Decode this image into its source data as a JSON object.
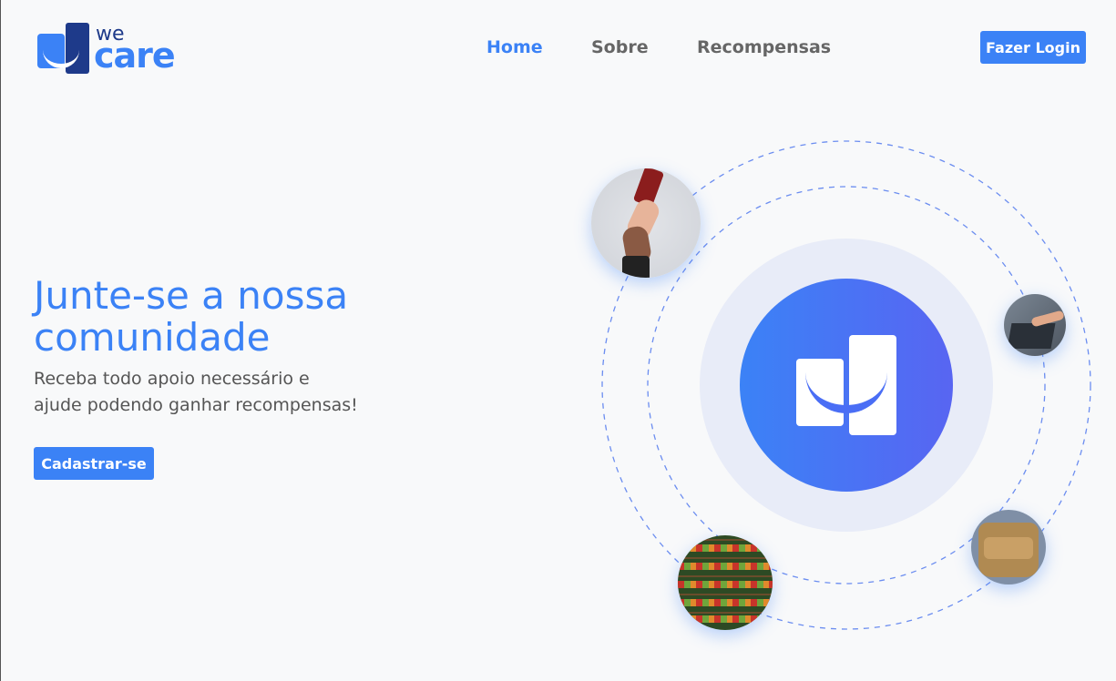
{
  "brand": {
    "line1": "we",
    "line2": "care"
  },
  "nav": {
    "home": "Home",
    "about": "Sobre",
    "rewards": "Recompensas"
  },
  "header": {
    "login_label": "Fazer Login"
  },
  "hero": {
    "title_line1": "Junte-se a nossa",
    "title_line2": "comunidade",
    "subtitle_line1": "Receba todo apoio necessário e",
    "subtitle_line2": "ajude podendo ganhar recompensas!",
    "signup_label": "Cadastrar-se"
  },
  "colors": {
    "primary": "#3b82f6",
    "dark": "#1e3a8a",
    "nav_inactive": "#666666",
    "gradient_end": "#5865f2"
  },
  "icons": [
    "wecare-logo-icon",
    "wecare-core-icon"
  ]
}
